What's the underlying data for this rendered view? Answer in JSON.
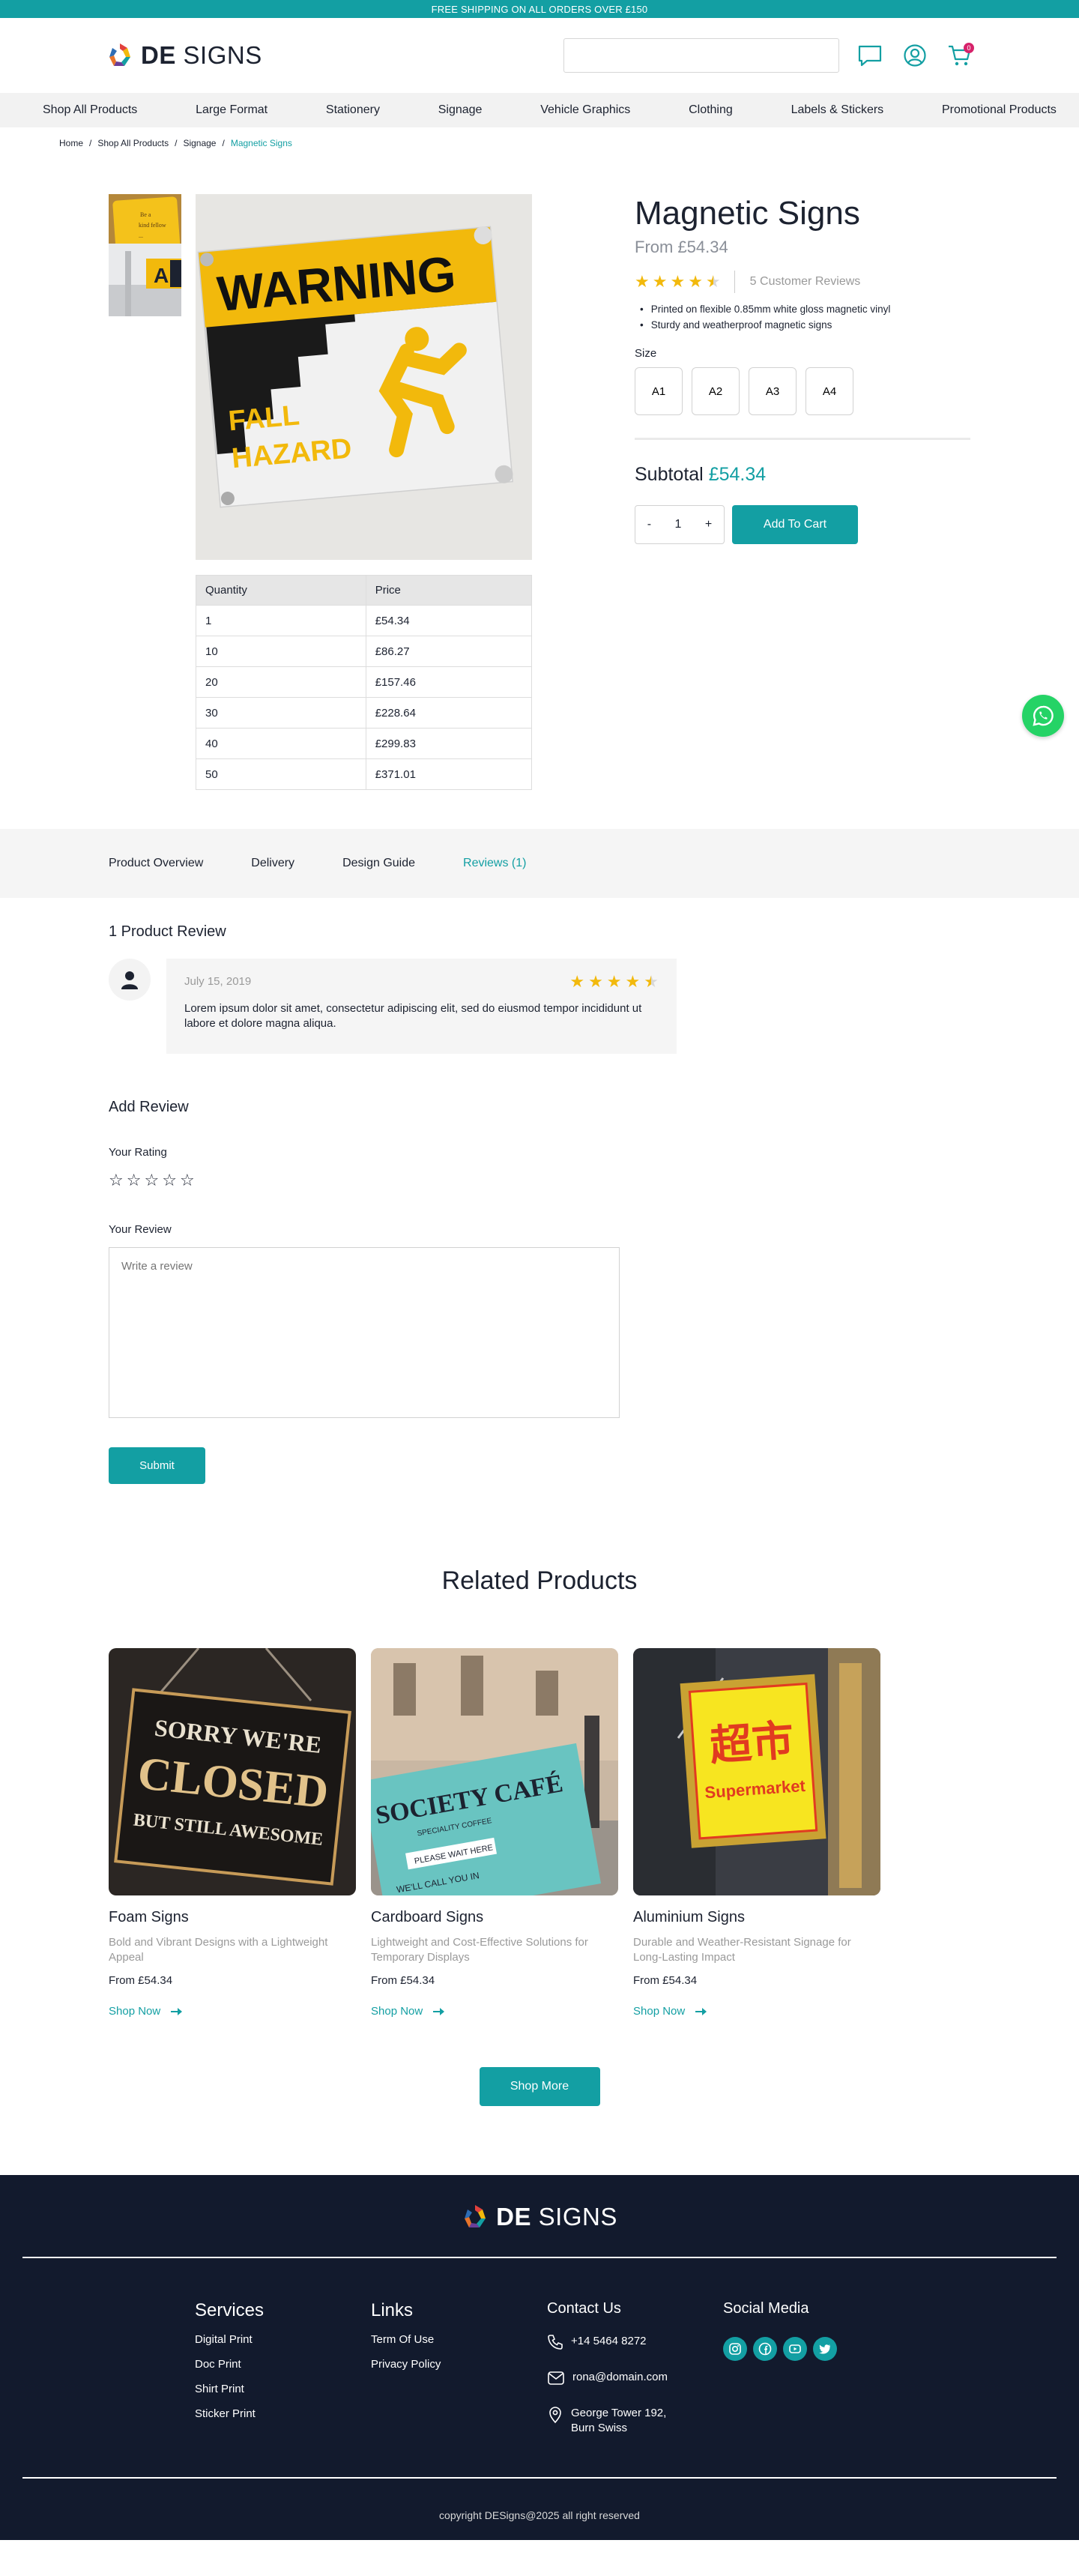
{
  "topbar": {
    "text": "FREE SHIPPING ON ALL ORDERS OVER £150"
  },
  "header": {
    "logo_bold": "DE",
    "logo_light": "SIGNS",
    "search_placeholder": "",
    "cart_count": "0",
    "icons": [
      "chat-icon",
      "user-icon",
      "cart-icon"
    ]
  },
  "nav": [
    "Shop All Products",
    "Large Format",
    "Stationery",
    "Signage",
    "Vehicle Graphics",
    "Clothing",
    "Labels & Stickers",
    "Promotional Products"
  ],
  "breadcrumb": [
    "Home",
    "Shop All Products",
    "Signage",
    "Magnetic Signs"
  ],
  "product": {
    "title": "Magnetic Signs",
    "from_price": "From £54.34",
    "rating": 4.5,
    "reviews_label": "5 Customer Reviews",
    "bullets": [
      "Printed on flexible 0.85mm white gloss magnetic vinyl",
      "Sturdy and weatherproof magnetic signs"
    ],
    "size_label": "Size",
    "sizes": [
      "A1",
      "A2",
      "A3",
      "A4"
    ],
    "subtotal_label": "Subtotal",
    "subtotal_value": "£54.34",
    "qty_minus": "-",
    "qty_value": "1",
    "qty_plus": "+",
    "add_to_cart": "Add To Cart",
    "image_text": {
      "line1": "WARNING",
      "line2": "FALL",
      "line3": "HAZARD"
    }
  },
  "price_table": {
    "headers": [
      "Quantity",
      "Price"
    ],
    "rows": [
      [
        "1",
        "£54.34"
      ],
      [
        "10",
        "£86.27"
      ],
      [
        "20",
        "£157.46"
      ],
      [
        "30",
        "£228.64"
      ],
      [
        "40",
        "£299.83"
      ],
      [
        "50",
        "£371.01"
      ]
    ]
  },
  "tabs": [
    "Product Overview",
    "Delivery",
    "Design Guide",
    "Reviews (1)"
  ],
  "active_tab": 3,
  "reviews": {
    "count_heading": "1 Product Review",
    "items": [
      {
        "date": "July 15, 2019",
        "rating": 4.5,
        "text": "Lorem ipsum dolor sit amet, consectetur adipiscing elit, sed do eiusmod tempor incididunt ut labore et dolore magna aliqua."
      }
    ],
    "add_heading": "Add Review",
    "your_rating": "Your Rating",
    "your_review": "Your Review",
    "review_placeholder": "Write a review",
    "submit": "Submit"
  },
  "related": {
    "title": "Related Products",
    "items": [
      {
        "name": "Foam Signs",
        "desc": "Bold and Vibrant Designs with a Lightweight Appeal",
        "price": "From £54.34",
        "cta": "Shop Now"
      },
      {
        "name": "Cardboard Signs",
        "desc": "Lightweight and Cost-Effective Solutions for Temporary Displays",
        "price": "From £54.34",
        "cta": "Shop Now"
      },
      {
        "name": "Aluminium Signs",
        "desc": "Durable and Weather-Resistant Signage for Long-Lasting Impact",
        "price": "From £54.34",
        "cta": "Shop Now"
      }
    ],
    "images": {
      "foam": {
        "l1": "SORRY WE'RE",
        "l2": "CLOSED",
        "l3": "BUT STILL AWESOME"
      },
      "cardboard": {
        "l1": "SOCIETY CAFÉ",
        "l2": "SPECIALITY COFFEE",
        "l3": "PLEASE WAIT HERE",
        "l4": "WE'LL CALL YOU IN"
      },
      "aluminium": {
        "l1": "超市",
        "l2": "Supermarket"
      }
    },
    "shop_more": "Shop More"
  },
  "footer": {
    "services_title": "Services",
    "services": [
      "Digital Print",
      "Doc Print",
      "Shirt Print",
      "Sticker Print"
    ],
    "links_title": "Links",
    "links": [
      "Term Of Use",
      "Privacy Policy"
    ],
    "contact_title": "Contact Us",
    "phone": "+14 5464 8272",
    "email": "rona@domain.com",
    "address_line1": "George Tower 192,",
    "address_line2": "Burn Swiss",
    "social_title": "Social Media",
    "socials": [
      "instagram-icon",
      "facebook-icon",
      "youtube-icon",
      "twitter-icon"
    ],
    "copyright": "copyright DESigns@2025 all right reserved"
  },
  "colors": {
    "accent": "#139fa3",
    "star": "#f2b90c",
    "footer_bg": "#121a2d",
    "badge": "#d6226a"
  }
}
